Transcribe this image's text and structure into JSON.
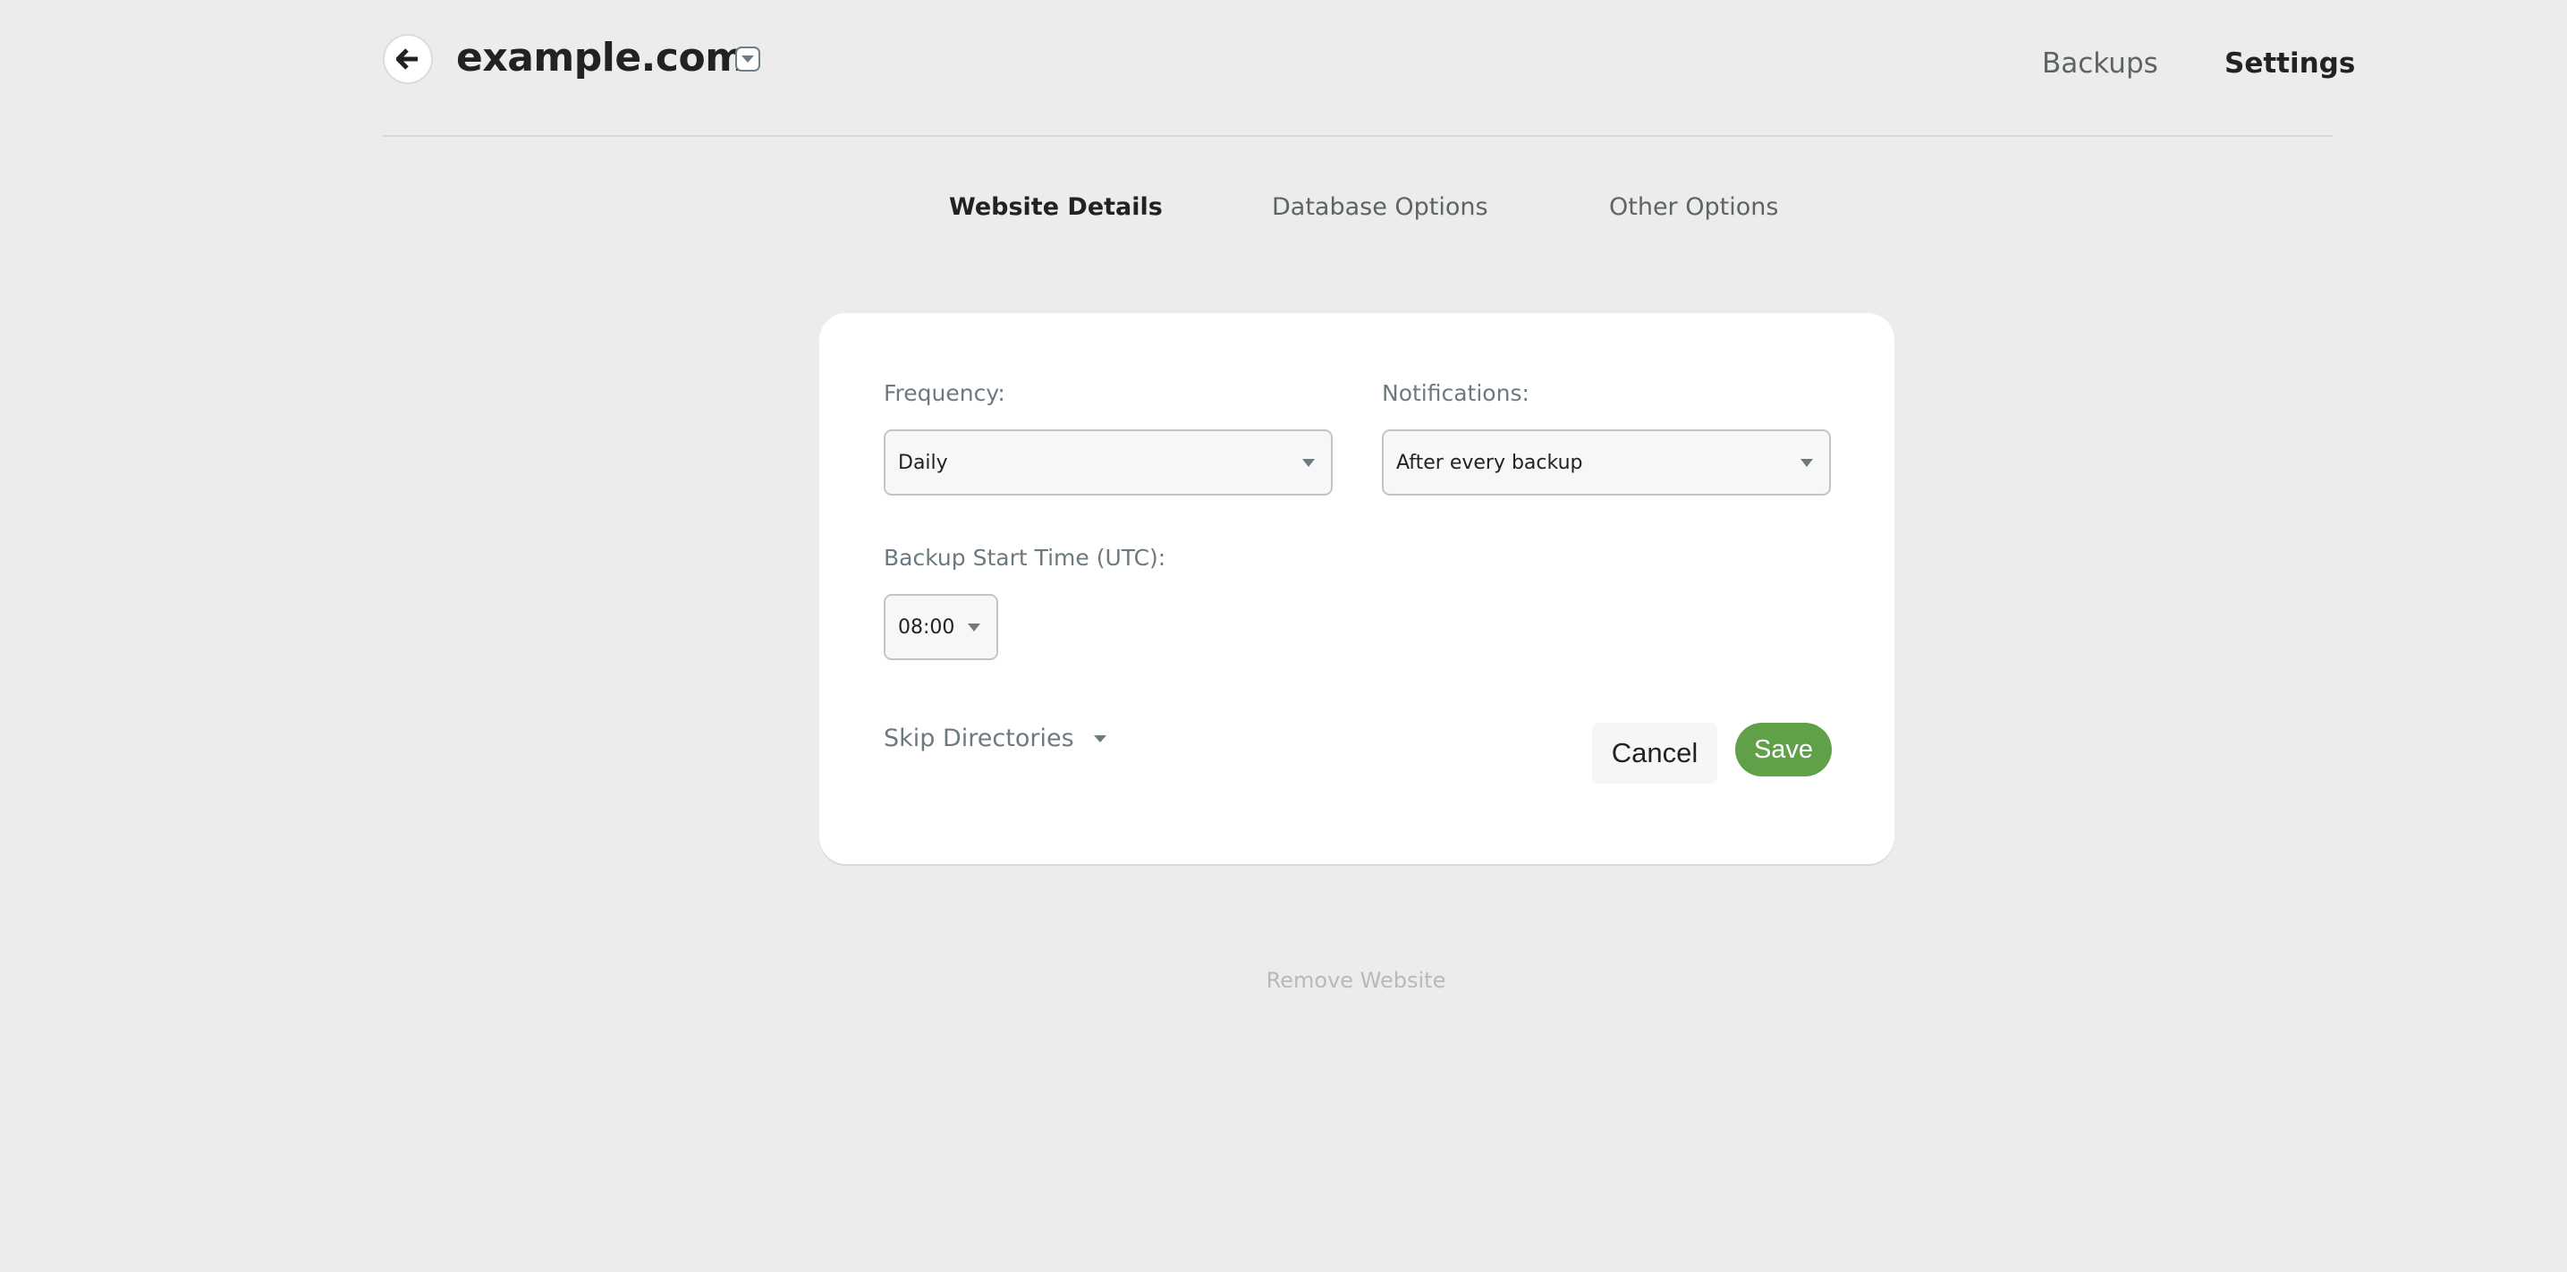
{
  "header": {
    "site_title": "example.com",
    "nav": [
      {
        "label": "Backups",
        "active": false
      },
      {
        "label": "Settings",
        "active": true
      }
    ]
  },
  "subtabs": [
    {
      "label": "Website Details",
      "active": true
    },
    {
      "label": "Database Options",
      "active": false
    },
    {
      "label": "Other Options",
      "active": false
    }
  ],
  "form": {
    "frequency": {
      "label": "Frequency:",
      "value": "Daily"
    },
    "notifications": {
      "label": "Notifications:",
      "value": "After every backup"
    },
    "start_time": {
      "label": "Backup Start Time (UTC):",
      "value": "08:00"
    },
    "skip_directories": "Skip Directories",
    "cancel_label": "Cancel",
    "save_label": "Save"
  },
  "footer": {
    "remove_label": "Remove Website"
  },
  "colors": {
    "accent": "#60a048",
    "background": "#ececec"
  }
}
